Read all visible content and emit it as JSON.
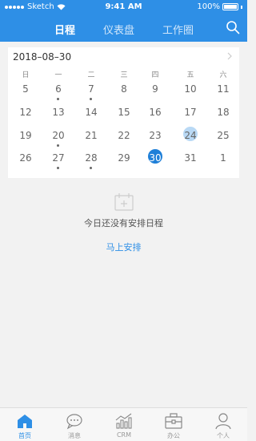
{
  "status_bar": {
    "carrier": "Sketch",
    "time": "9:41 AM",
    "battery": "100%"
  },
  "header": {
    "tabs": [
      {
        "label": "日程",
        "active": true
      },
      {
        "label": "仪表盘",
        "active": false
      },
      {
        "label": "工作圈",
        "active": false
      }
    ],
    "search_icon": "search-icon"
  },
  "calendar": {
    "date": "2018–08–30",
    "weekdays": [
      "日",
      "一",
      "二",
      "三",
      "四",
      "五",
      "六"
    ],
    "rows": [
      [
        {
          "d": "5"
        },
        {
          "d": "6",
          "dot": true
        },
        {
          "d": "7",
          "dot": true
        },
        {
          "d": "8"
        },
        {
          "d": "9"
        },
        {
          "d": "10"
        },
        {
          "d": "11"
        }
      ],
      [
        {
          "d": "12"
        },
        {
          "d": "13"
        },
        {
          "d": "14"
        },
        {
          "d": "15"
        },
        {
          "d": "16"
        },
        {
          "d": "17"
        },
        {
          "d": "18"
        }
      ],
      [
        {
          "d": "19"
        },
        {
          "d": "20",
          "dot": true
        },
        {
          "d": "21"
        },
        {
          "d": "22"
        },
        {
          "d": "23"
        },
        {
          "d": "24",
          "state": "today"
        },
        {
          "d": "25"
        }
      ],
      [
        {
          "d": "26"
        },
        {
          "d": "27",
          "dot": true
        },
        {
          "d": "28",
          "dot": true
        },
        {
          "d": "29"
        },
        {
          "d": "30",
          "state": "selected"
        },
        {
          "d": "31"
        },
        {
          "d": "1"
        }
      ]
    ]
  },
  "empty_state": {
    "message": "今日还没有安排日程",
    "action": "马上安排"
  },
  "tabbar": [
    {
      "label": "首页",
      "icon": "home-icon",
      "active": true
    },
    {
      "label": "消息",
      "icon": "chat-icon",
      "active": false
    },
    {
      "label": "CRM",
      "icon": "chart-icon",
      "active": false
    },
    {
      "label": "办公",
      "icon": "briefcase-icon",
      "active": false
    },
    {
      "label": "个人",
      "icon": "person-icon",
      "active": false
    }
  ],
  "colors": {
    "accent": "#2e8fe6",
    "selected": "#1e7fd8",
    "today": "#b9d9f5"
  }
}
